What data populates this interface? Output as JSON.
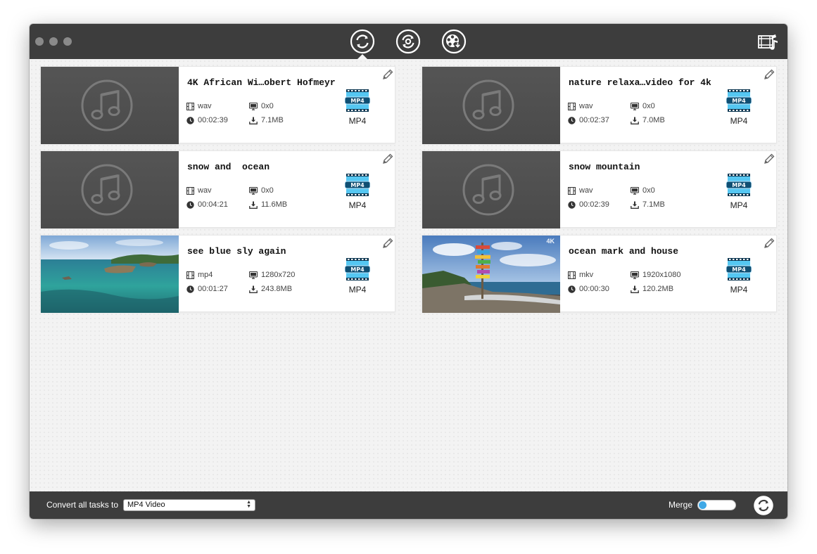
{
  "toolbar": {
    "tabs": [
      "convert",
      "enhance",
      "video-download"
    ],
    "active_tab": "convert"
  },
  "tasks": [
    {
      "title": "4K African Wi…obert Hofmeyr",
      "format": "wav",
      "resolution": "0x0",
      "duration": "00:02:39",
      "size": "7.1MB",
      "output": "MP4",
      "thumb": "music"
    },
    {
      "title": "nature relaxa…video for 4k",
      "format": "wav",
      "resolution": "0x0",
      "duration": "00:02:37",
      "size": "7.0MB",
      "output": "MP4",
      "thumb": "music"
    },
    {
      "title": "snow and  ocean",
      "format": "wav",
      "resolution": "0x0",
      "duration": "00:04:21",
      "size": "11.6MB",
      "output": "MP4",
      "thumb": "music"
    },
    {
      "title": "snow mountain",
      "format": "wav",
      "resolution": "0x0",
      "duration": "00:02:39",
      "size": "7.1MB",
      "output": "MP4",
      "thumb": "music"
    },
    {
      "title": "see blue sly again",
      "format": "mp4",
      "resolution": "1280x720",
      "duration": "00:01:27",
      "size": "243.8MB",
      "output": "MP4",
      "thumb": "sea"
    },
    {
      "title": "ocean mark and house",
      "format": "mkv",
      "resolution": "1920x1080",
      "duration": "00:00:30",
      "size": "120.2MB",
      "output": "MP4",
      "thumb": "coast"
    }
  ],
  "footer": {
    "convert_label": "Convert all tasks to",
    "convert_target": "MP4 Video",
    "merge_label": "Merge",
    "merge_on": false
  },
  "badge": {
    "mp4_text": "MP4",
    "corner_mark": "4K"
  },
  "colors": {
    "titlebar": "#3d3d3d",
    "accent": "#3fa8e6",
    "badge": "#29a8e0"
  }
}
